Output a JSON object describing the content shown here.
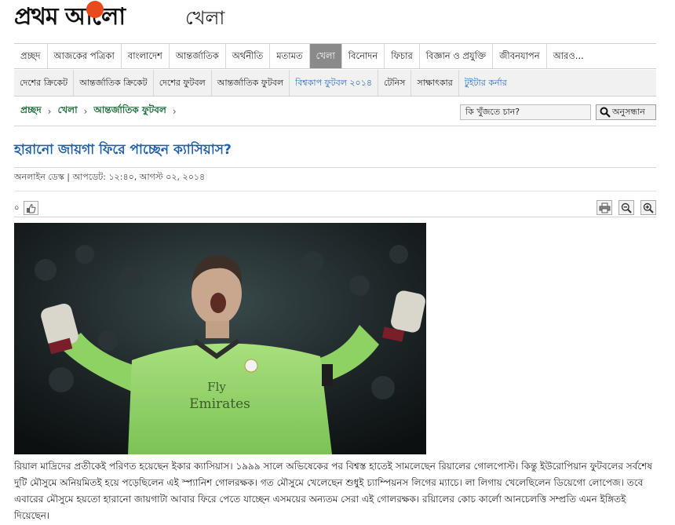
{
  "site": {
    "logo_text": "প্রথম আলো",
    "section": "খেলা"
  },
  "main_nav": [
    "প্রচ্ছদ",
    "আজকের পত্রিকা",
    "বাংলাদেশ",
    "আন্তর্জাতিক",
    "অর্থনীতি",
    "মতামত",
    "খেলা",
    "বিনোদন",
    "ফিচার",
    "বিজ্ঞান ও প্রযুক্তি",
    "জীবনযাপন",
    "আরও..."
  ],
  "sub_nav": [
    "দেশের ক্রিকেট",
    "আন্তর্জাতিক ক্রিকেট",
    "দেশের ফুটবল",
    "আন্তর্জাতিক ফুটবল",
    "বিশ্বকাপ ফুটবল ২০১৪",
    "টেনিস",
    "সাক্ষাৎকার",
    "টুইটার কর্নার"
  ],
  "breadcrumb": [
    "প্রচ্ছদ",
    "খেলা",
    "আন্তর্জাতিক ফুটবল"
  ],
  "search": {
    "placeholder": "কি খুঁজতে চান?",
    "button": "অনুসন্ধান"
  },
  "article": {
    "headline": "হারানো জায়গা ফিরে পাচ্ছেন ক্যাসিয়াস?",
    "meta": "অনলাইন ডেস্ক | আপডেট: ১২:৪০, আগস্ট ০২, ২০১৪",
    "like_count": "০",
    "photo_text": {
      "brand": "Fly",
      "sponsor": "Emirates"
    },
    "body": "রিয়াল মাদ্রিদের প্রতীকেই পরিণত হয়েছেন ইকার ক্যাসিয়াস। ১৯৯৯ সালে অভিষেকের পর বিশ্বস্ত হাতেই সামলেছেন রিয়ালের গোলপোস্ট। কিন্তু ইউরোপিয়ান ফুটবলের সর্বশেষ দুটি মৌসুমে অনিয়মিতই হয়ে পড়েছিলেন এই স্প্যানিশ গোলরক্ষক। গত মৌসুমে খেলেছেন শুধুই চ্যাম্পিয়নস লিগের ম্যাচে। লা লিগায় খেলেছিলেন ডিয়েগো লোপেজ। তবে এবারের মৌসুমে হয়তো হারানো জায়গাটা আবার ফিরে পেতে যাচ্ছেন এসময়ের অন্যতম সেরা এই গোলরক্ষক। রয়িালের কোচ কার্লো আনচেলত্তি সম্প্রতি এমন ইঙ্গিতই দিয়েছেন।"
  },
  "colors": {
    "headline": "#1f5ea8",
    "breadcrumb": "#1b6b38",
    "active_tab": "#8a8a8a",
    "logo_sun": "#e8491d"
  },
  "icons": [
    "magnifier-icon",
    "thumbs-up-icon",
    "print-icon",
    "zoom-out-icon",
    "zoom-in-icon"
  ]
}
